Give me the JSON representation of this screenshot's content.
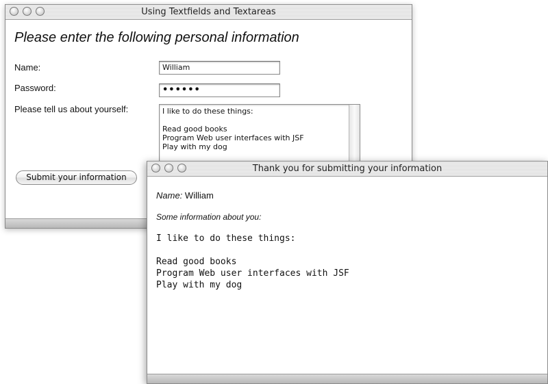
{
  "form_window": {
    "title": "Using Textfields and Textareas",
    "heading": "Please enter the following personal information",
    "name_label": "Name:",
    "name_value": "William",
    "password_label": "Password:",
    "password_value": "••••••",
    "about_label": "Please tell us about yourself:",
    "about_value": "I like to do these things:\n\nRead good books\nProgram Web user interfaces with JSF\nPlay with my dog",
    "submit_label": "Submit your information"
  },
  "result_window": {
    "title": "Thank you for submitting your information",
    "name_label": "Name:",
    "name_value": "William",
    "info_label": "Some information about you:",
    "info_text": "I like to do these things:\n\nRead good books\nProgram Web user interfaces with JSF\nPlay with my dog"
  }
}
